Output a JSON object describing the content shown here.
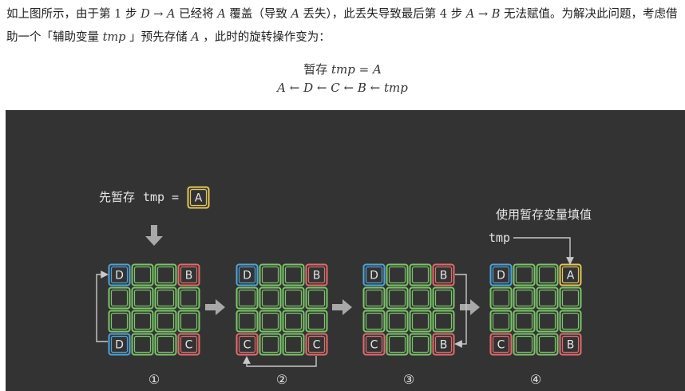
{
  "paragraph": {
    "s1": "如上图所示，由于第 ",
    "step1": "1",
    "s2": " 步 ",
    "expr1": "D → A",
    "s3": " 已经将 ",
    "var_a1": "A",
    "s4": " 覆盖（导致 ",
    "var_a2": "A",
    "s5": " 丢失），此丢失导致最后第 ",
    "step4": "4",
    "s6": " 步 ",
    "expr2": "A → B",
    "s7": " 无法赋值。为解决此问题，考虑借助一个「辅助变量 ",
    "var_tmp": "tmp",
    "s8": " 」预先存储 ",
    "var_a3": "A",
    "s9": " ，此时的旋转操作变为："
  },
  "formula": {
    "line1_prefix": "暂存 ",
    "line1_expr": "tmp = A",
    "line2_expr": "A ← D ← C ← B ← tmp"
  },
  "figure": {
    "step1_text": "先暂存",
    "step1_var": "tmp",
    "step1_eq": "=",
    "step1_box": "A",
    "step4_title": "使用暂存变量填值",
    "step4_var": "tmp",
    "step_labels": [
      "①",
      "②",
      "③",
      "④"
    ],
    "grids": [
      {
        "tl": "D",
        "tr": "B",
        "bl": "D",
        "br": "C"
      },
      {
        "tl": "D",
        "tr": "B",
        "bl": "C",
        "br": "C"
      },
      {
        "tl": "D",
        "tr": "B",
        "bl": "C",
        "br": "B"
      },
      {
        "tl": "D",
        "tr": "A",
        "bl": "C",
        "br": "B"
      }
    ]
  },
  "colors": {
    "background": "#333333",
    "blue": "#4fa3d8",
    "red": "#e06c6c",
    "green": "#7cc46b",
    "yellow": "#e2c75a",
    "text": "#e6e6e6",
    "arrow": "#a8a8a8"
  }
}
